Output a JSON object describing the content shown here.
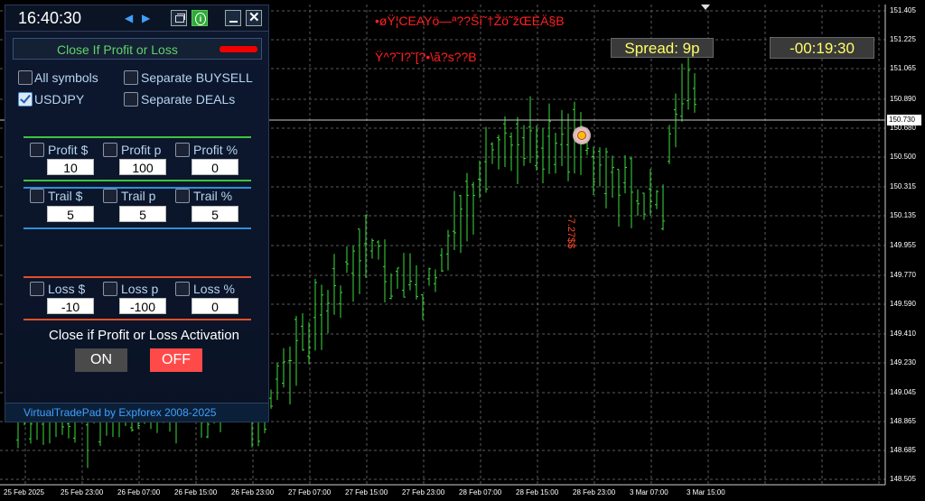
{
  "chart": {
    "price_labels": [
      "151.405",
      "151.225",
      "151.065",
      "150.890",
      "150.730",
      "150.680",
      "150.500",
      "150.315",
      "150.135",
      "149.955",
      "149.770",
      "149.590",
      "149.410",
      "149.230",
      "149.045",
      "148.865",
      "148.685",
      "148.505"
    ],
    "current_price": "150.730",
    "date_labels": [
      "25 Feb 2025",
      "25 Feb 23:00",
      "26 Feb 07:00",
      "26 Feb 15:00",
      "26 Feb 23:00",
      "27 Feb 07:00",
      "27 Feb 15:00",
      "27 Feb 23:00",
      "28 Feb 07:00",
      "28 Feb 15:00",
      "28 Feb 23:00",
      "3 Mar 07:00",
      "3 Mar 15:00"
    ],
    "garbled_line1": "•øŸ¦CEAYö—ª??Ší˜†Žö˜žŒÈÄ§B",
    "garbled_line2": "Ÿ^?˜I?˜[?•\\ã?s??B",
    "spread": "Spread: 9p",
    "timer": "-00:19:30",
    "vertical_label": "-7.27$$",
    "colors": {
      "candle": "#3ddc3d",
      "grid": "#5a5a5a",
      "text_red": "#ff2020",
      "spread_text": "#ffff66"
    }
  },
  "panel": {
    "clock": "16:40:30",
    "header_title": "Close If Profit or Loss",
    "options": {
      "all_symbols": "All symbols",
      "separate_buysell": "Separate BUYSELL",
      "usdjpy": "USDJPY",
      "separate_deals": "Separate DEALs"
    },
    "profit": {
      "dollar": "Profit $",
      "points": "Profit p",
      "percent": "Profit %",
      "v_dollar": "10",
      "v_points": "100",
      "v_percent": "0"
    },
    "trail": {
      "dollar": "Trail $",
      "points": "Trail p",
      "percent": "Trail %",
      "v_dollar": "5",
      "v_points": "5",
      "v_percent": "5"
    },
    "loss": {
      "dollar": "Loss $",
      "points": "Loss p",
      "percent": "Loss %",
      "v_dollar": "-10",
      "v_points": "-100",
      "v_percent": "0"
    },
    "activation_label": "Close if Profit or Loss Activation",
    "on_label": "ON",
    "off_label": "OFF",
    "footer": "VirtualTradePad by Expforex 2008-2025"
  }
}
